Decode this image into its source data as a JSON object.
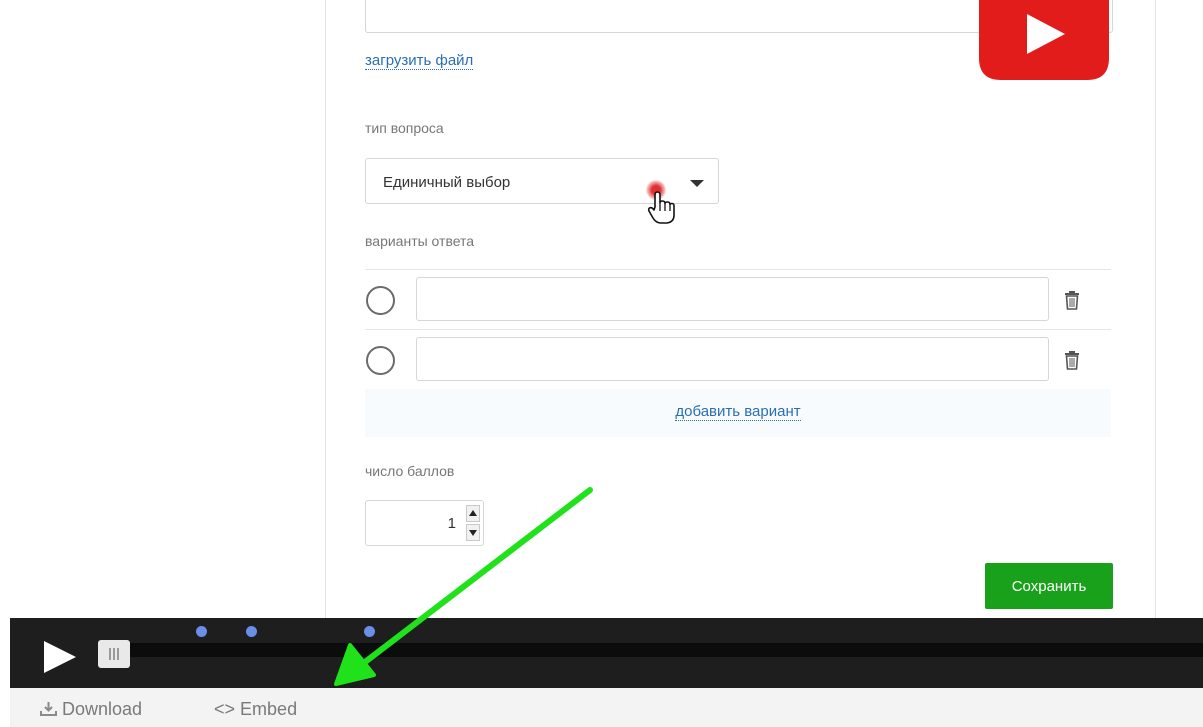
{
  "form": {
    "upload_link": "загрузить файл",
    "question_type_label": "тип вопроса",
    "question_type_value": "Единичный выбор",
    "answers_label": "варианты ответа",
    "answers": [
      {
        "value": ""
      },
      {
        "value": ""
      }
    ],
    "add_option_link": "добавить вариант",
    "score_label": "число баллов",
    "score_value": "1",
    "save_label": "Сохранить"
  },
  "player": {
    "download_label": "Download",
    "embed_label": "Embed",
    "marker_color": "#6b8fe6"
  },
  "colors": {
    "save_button": "#1aa11c",
    "link": "#2a6fb5",
    "annotation_arrow": "#1fe21a",
    "youtube_red": "#e21b1b"
  },
  "icons": [
    "youtube-logo-icon",
    "dropdown-caret-icon",
    "hand-pointer-icon",
    "radio-icon",
    "trash-icon",
    "stepper-up-icon",
    "stepper-down-icon",
    "play-icon",
    "download-icon",
    "embed-icon",
    "arrow-icon"
  ]
}
